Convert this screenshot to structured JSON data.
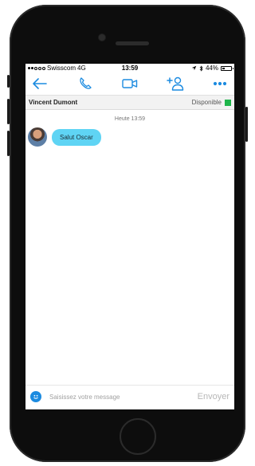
{
  "status_bar": {
    "carrier": "Swisscom",
    "network": "4G",
    "time": "13:59",
    "battery_text": "44%",
    "battery_level": 0.44
  },
  "toolbar": {
    "icons": [
      "back-arrow-icon",
      "phone-icon",
      "video-camera-icon",
      "add-person-icon",
      "more-icon"
    ],
    "accent_color": "#1c8be0"
  },
  "contact": {
    "name": "Vincent Dumont",
    "presence": "Disponible",
    "presence_color": "#1fb54b"
  },
  "conversation": {
    "timestamp": "Heute 13:59",
    "messages": [
      {
        "text": "Salut Oscar",
        "bubble_color": "#5fd4f4"
      }
    ]
  },
  "composer": {
    "placeholder": "Saisissez votre message",
    "value": "",
    "send_label": "Envoyer"
  }
}
